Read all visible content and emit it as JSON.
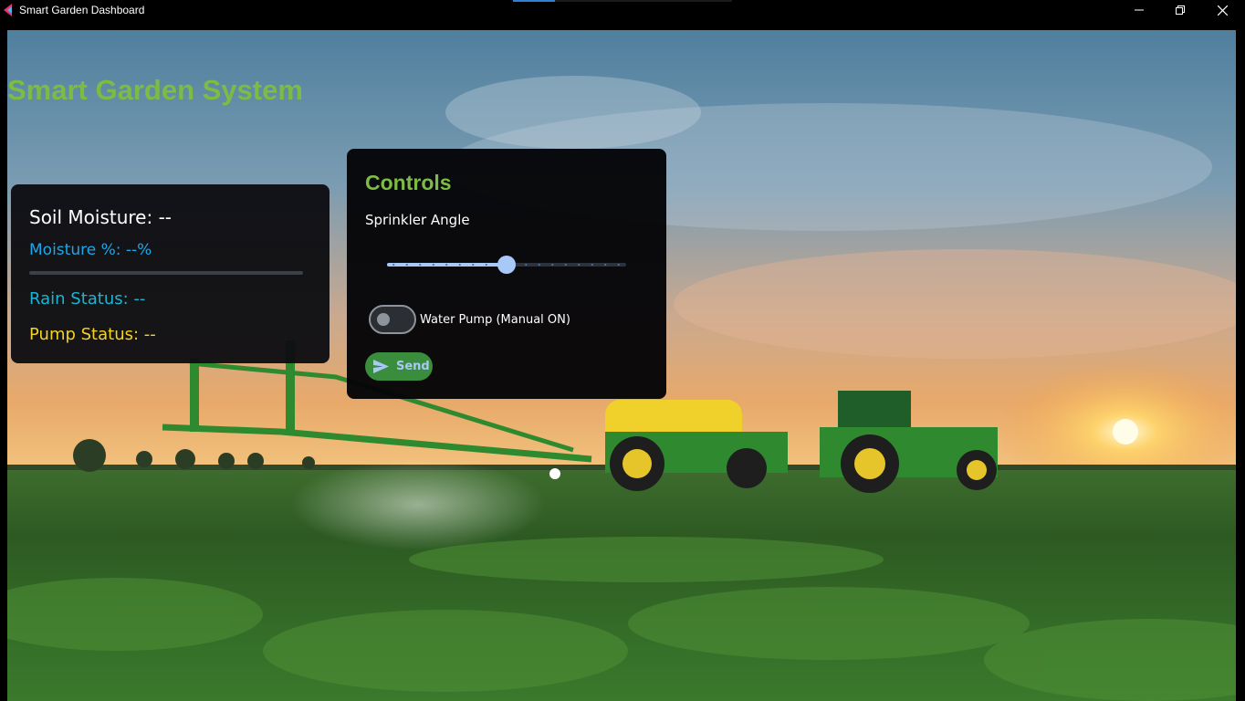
{
  "window": {
    "title": "Smart Garden Dashboard",
    "minimize_icon": "minimize-icon",
    "maximize_icon": "restore-icon",
    "close_icon": "close-icon"
  },
  "app": {
    "heading": "Smart Garden System",
    "accent_color": "#7dbb44",
    "background": "farm-field-sunset-with-tractor-sprayer"
  },
  "status": {
    "soil_moisture": "Soil Moisture: --",
    "moisture_percent": "Moisture %: --%",
    "moisture_progress": 0,
    "rain_status": "Rain Status: --",
    "pump_status": "Pump Status: --",
    "colors": {
      "moisture": "#1ea7e8",
      "rain": "#19b6d4",
      "pump": "#f4d323"
    }
  },
  "controls": {
    "title": "Controls",
    "sprinkler_angle_label": "Sprinkler Angle",
    "sprinkler_angle_fraction": 0.5,
    "slider_ticks": 19,
    "water_pump_label": "Water Pump (Manual ON)",
    "water_pump_on": false,
    "send_label": "Send",
    "send_icon": "send-icon"
  }
}
